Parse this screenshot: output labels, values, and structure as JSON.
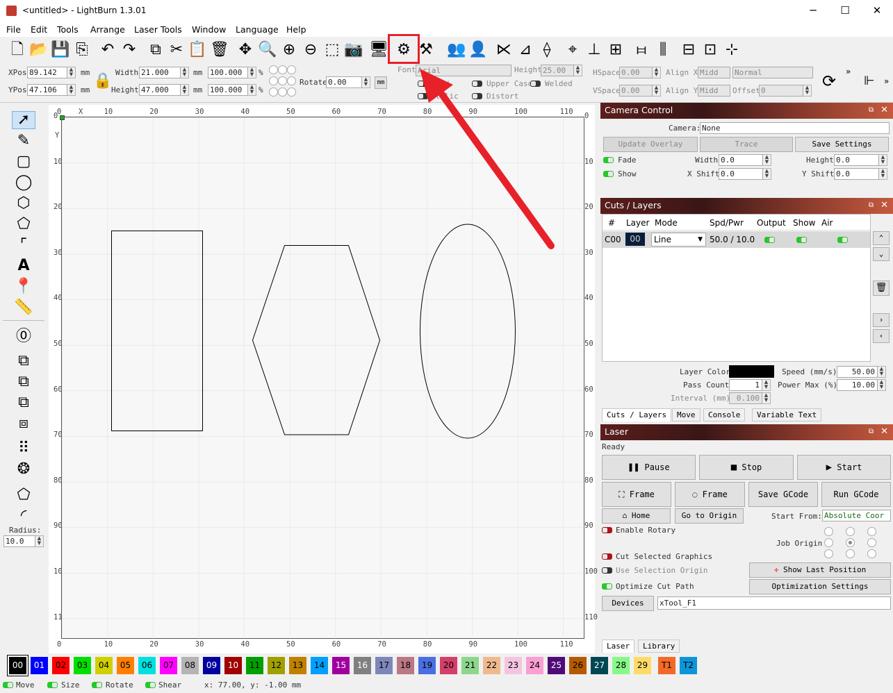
{
  "window": {
    "title": "<untitled> - LightBurn 1.3.01",
    "minimize": "─",
    "maximize": "☐",
    "close": "✕"
  },
  "menu": [
    "File",
    "Edit",
    "Tools",
    "Arrange",
    "Laser Tools",
    "Window",
    "Language",
    "Help"
  ],
  "toolbar_icons": [
    "new-file",
    "open-file",
    "save-file",
    "import",
    "undo",
    "redo",
    "copy",
    "cut",
    "paste",
    "delete",
    "move",
    "zoom-fit",
    "zoom-in",
    "zoom-out",
    "select-rect",
    "camera",
    "monitor",
    "settings-gears",
    "machine-tools",
    "group",
    "ungroup",
    "mirror-h",
    "mirror-v",
    "flip",
    "center",
    "align-bottom",
    "align-h",
    "distribute-h",
    "distribute-v",
    "dock",
    "snap"
  ],
  "props": {
    "xpos_label": "XPos",
    "xpos": "89.142",
    "ypos_label": "YPos",
    "ypos": "47.106",
    "unit": "mm",
    "width_label": "Width",
    "width": "21.000",
    "height_label": "Height",
    "height": "47.000",
    "scale_w": "100.000",
    "scale_h": "100.000",
    "pct": "%",
    "rotate_label": "Rotate",
    "rotate": "0.00",
    "mm_btn": "mm"
  },
  "font": {
    "font_label": "Font",
    "font_value": "Arial",
    "height_label": "Height",
    "height": "25.00",
    "bold": "Bold",
    "italic": "Italic",
    "upper_case": "Upper Case",
    "welded": "Welded",
    "distort": "Distort",
    "hspace_label": "HSpace",
    "hspace": "0.00",
    "vspace_label": "VSpace",
    "vspace": "0.00",
    "alignx_label": "Align X",
    "alignx": "Midd",
    "aligny_label": "Align Y",
    "aligny": "Midd",
    "normal": "Normal",
    "offset_label": "Offset",
    "offset": "0"
  },
  "ruler": {
    "top": [
      "0",
      "10",
      "20",
      "30",
      "40",
      "50",
      "60",
      "70",
      "80",
      "90",
      "100",
      "110"
    ],
    "x": "X",
    "y": "Y",
    "left": [
      "0",
      "10",
      "20",
      "30",
      "40",
      "50",
      "60",
      "70",
      "80",
      "90",
      "100",
      "110"
    ],
    "right": [
      "0",
      "10",
      "20",
      "30",
      "40",
      "50",
      "60",
      "70",
      "80",
      "90",
      "100",
      "110"
    ]
  },
  "left_tools": {
    "radius_label": "Radius:",
    "radius": "10.0"
  },
  "camera": {
    "title": "Camera Control",
    "camera_label": "Camera:",
    "camera_value": "None",
    "update_overlay": "Update Overlay",
    "trace": "Trace",
    "save_settings": "Save Settings",
    "fade": "Fade",
    "show": "Show",
    "width_label": "Width",
    "width": "0.0",
    "height_label": "Height",
    "height": "0.0",
    "xshift_label": "X Shift",
    "xshift": "0.0",
    "yshift_label": "Y Shift",
    "yshift": "0.0"
  },
  "cuts": {
    "title": "Cuts / Layers",
    "headers": [
      "#",
      "Layer",
      "Mode",
      "Spd/Pwr",
      "Output",
      "Show",
      "Air"
    ],
    "row": {
      "id": "C00",
      "layer": "00",
      "mode": "Line",
      "spdpwr": "50.0 / 10.0"
    },
    "layer_color_label": "Layer Color",
    "speed_label": "Speed (mm/s)",
    "speed": "50.00",
    "pass_count_label": "Pass Count",
    "pass_count": "1",
    "power_max_label": "Power Max (%)",
    "power_max": "10.00",
    "interval_label": "Interval (mm)",
    "interval": "0.100",
    "tabs": [
      "Cuts / Layers",
      "Move",
      "Console",
      "Variable Text"
    ]
  },
  "laser": {
    "title": "Laser",
    "status": "Ready",
    "pause": "Pause",
    "stop": "Stop",
    "start": "Start",
    "frame1": "Frame",
    "frame2": "Frame",
    "save_gcode": "Save GCode",
    "run_gcode": "Run GCode",
    "home": "Home",
    "go_to_origin": "Go to Origin",
    "start_from_label": "Start From:",
    "start_from": "Absolute Coor",
    "enable_rotary": "Enable Rotary",
    "job_origin": "Job Origin",
    "cut_selected": "Cut Selected Graphics",
    "use_selection_origin": "Use Selection Origin",
    "show_last_position": "Show Last Position",
    "optimize_cut_path": "Optimize Cut Path",
    "optimization_settings": "Optimization Settings",
    "devices": "Devices",
    "device_value": "xTool_F1",
    "tabs": [
      "Laser",
      "Library"
    ]
  },
  "palette": [
    {
      "label": "00",
      "color": "#000000"
    },
    {
      "label": "01",
      "color": "#0000ff"
    },
    {
      "label": "02",
      "color": "#ff0000"
    },
    {
      "label": "03",
      "color": "#00e000"
    },
    {
      "label": "04",
      "color": "#d0d000"
    },
    {
      "label": "05",
      "color": "#ff8000"
    },
    {
      "label": "06",
      "color": "#00e0e0"
    },
    {
      "label": "07",
      "color": "#ff00ff"
    },
    {
      "label": "08",
      "color": "#b4b4b4"
    },
    {
      "label": "09",
      "color": "#0000a0"
    },
    {
      "label": "10",
      "color": "#a00000"
    },
    {
      "label": "11",
      "color": "#00a000"
    },
    {
      "label": "12",
      "color": "#a0a000"
    },
    {
      "label": "13",
      "color": "#c08000"
    },
    {
      "label": "14",
      "color": "#00a0ff"
    },
    {
      "label": "15",
      "color": "#a000a0"
    },
    {
      "label": "16",
      "color": "#808080"
    },
    {
      "label": "17",
      "color": "#7d87b9"
    },
    {
      "label": "18",
      "color": "#bb7784"
    },
    {
      "label": "19",
      "color": "#4a6fe3"
    },
    {
      "label": "20",
      "color": "#d33f6a"
    },
    {
      "label": "21",
      "color": "#8cd78c"
    },
    {
      "label": "22",
      "color": "#f0b98d"
    },
    {
      "label": "23",
      "color": "#f6c4e1"
    },
    {
      "label": "24",
      "color": "#fa9ed4"
    },
    {
      "label": "25",
      "color": "#500a78"
    },
    {
      "label": "26",
      "color": "#b45a00"
    },
    {
      "label": "27",
      "color": "#004754"
    },
    {
      "label": "28",
      "color": "#86fa88"
    },
    {
      "label": "29",
      "color": "#ffdb66"
    },
    {
      "label": "T1",
      "color": "#f36926"
    },
    {
      "label": "T2",
      "color": "#0c96d9"
    }
  ],
  "status": {
    "move": "Move",
    "size": "Size",
    "rotate": "Rotate",
    "shear": "Shear",
    "coords": "x: 77.00, y: -1.00 mm"
  }
}
